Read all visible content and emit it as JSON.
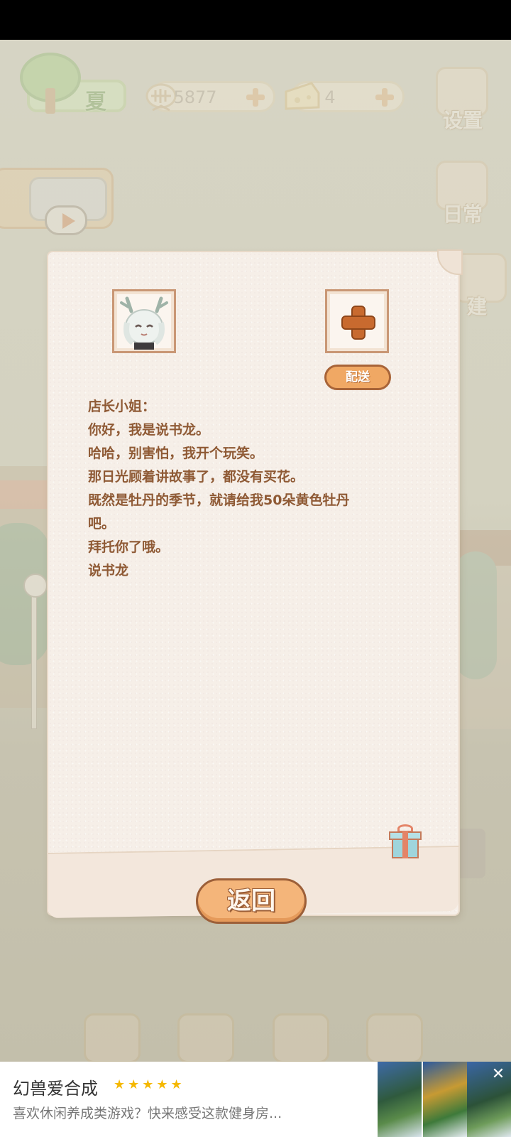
{
  "hud": {
    "season_label": "夏",
    "fish_count": "5877",
    "cheese_count": "4",
    "settings_label": "设置",
    "daily_label": "日常",
    "build_label": "建"
  },
  "letter": {
    "deliver_label": "配送",
    "lines": [
      "店长小姐：",
      "你好，我是说书龙。",
      "哈哈，别害怕，我开个玩笑。",
      "那日光顾着讲故事了，都没有买花。",
      "既然是牡丹的季节，就请给我50朵黄色牡丹",
      "吧。",
      "拜托你了哦。",
      "说书龙"
    ],
    "back_label": "返回"
  },
  "ad": {
    "title": "幻兽爱合成",
    "stars": "★★★★★",
    "description": "喜欢休闲养成类游戏？快来感受这款健身房...",
    "close": "✕"
  },
  "colors": {
    "text_brown": "#8f5a35",
    "button_orange": "#f0a864",
    "paper": "#f6efe8"
  }
}
